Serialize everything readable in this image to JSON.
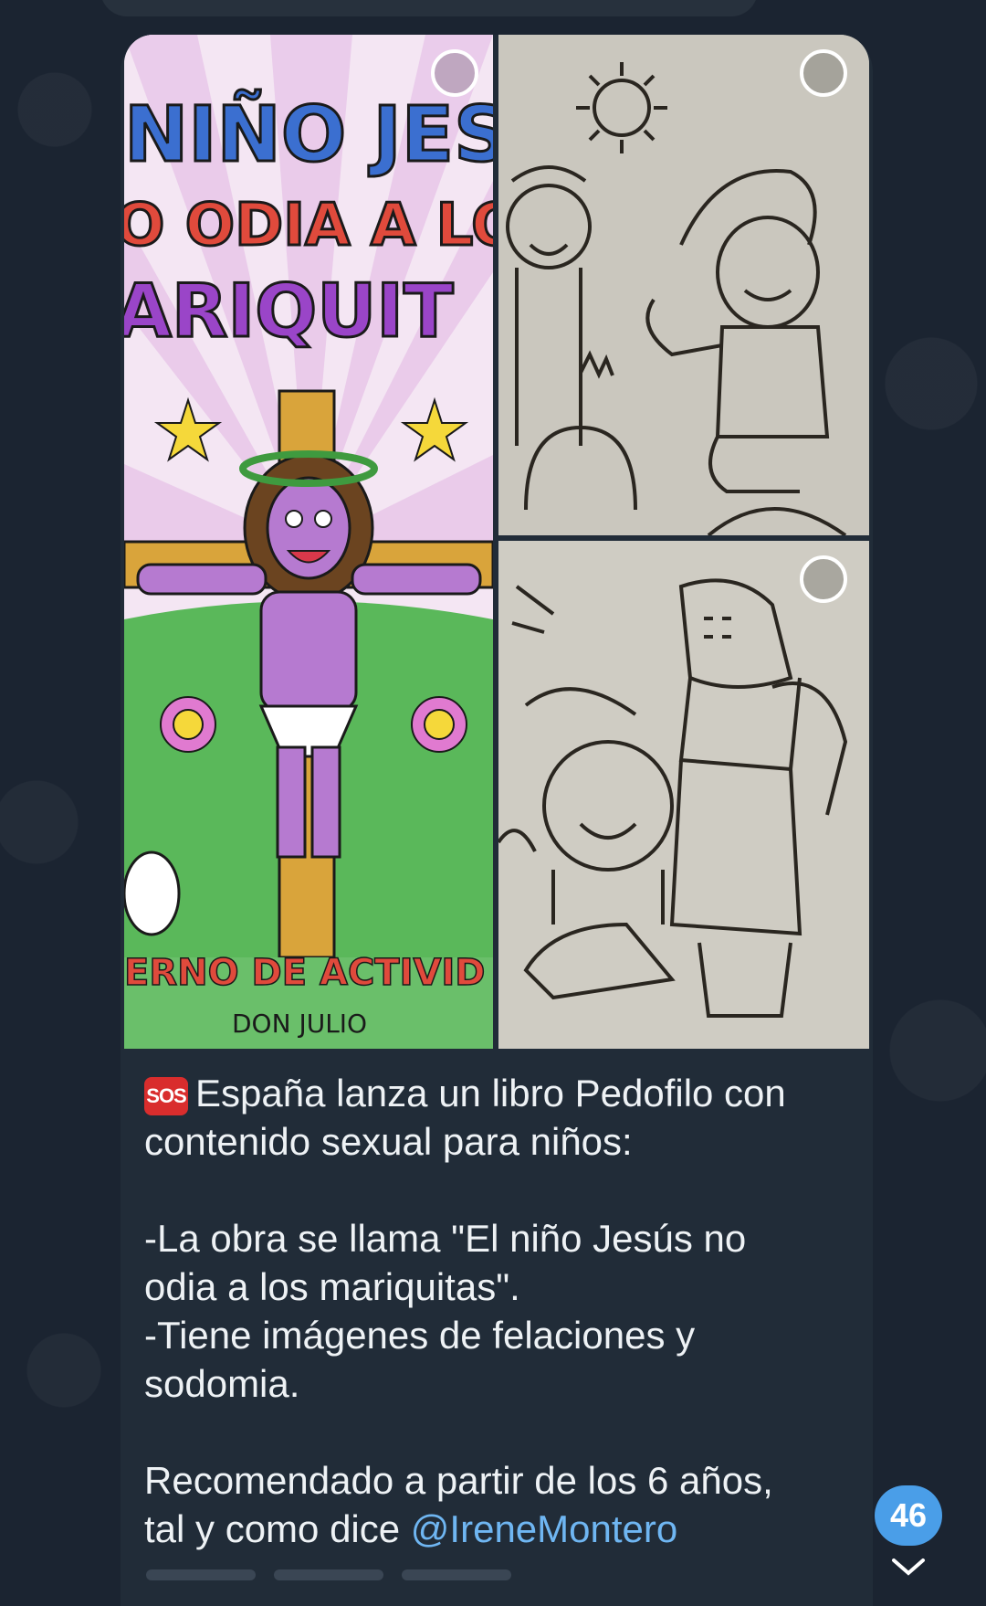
{
  "media": {
    "cover": {
      "title_line1": "NIÑO JES",
      "title_line2": "O ODIA A LO",
      "title_line3": "ARIQUIT",
      "subtitle": "ERNO DE ACTIVID",
      "author": "DON JULIO"
    }
  },
  "message": {
    "badge": "SOS",
    "lines": [
      "España lanza un libro Pedofilo con",
      "contenido sexual para niños:",
      "",
      "-La obra se llama \"El niño Jesús no",
      "odia a los mariquitas\".",
      "-Tiene imágenes de felaciones y",
      "sodomia.",
      "",
      "Recomendado a partir de los 6 años,"
    ],
    "last_line_prefix": "tal y como dice ",
    "mention": "@IreneMontero"
  },
  "unread_count": "46",
  "colors": {
    "background": "#1b2431",
    "bubble": "#212c38",
    "mention": "#6fb6f2",
    "badge": "#4a9ee8",
    "sos": "#d92d2d"
  }
}
